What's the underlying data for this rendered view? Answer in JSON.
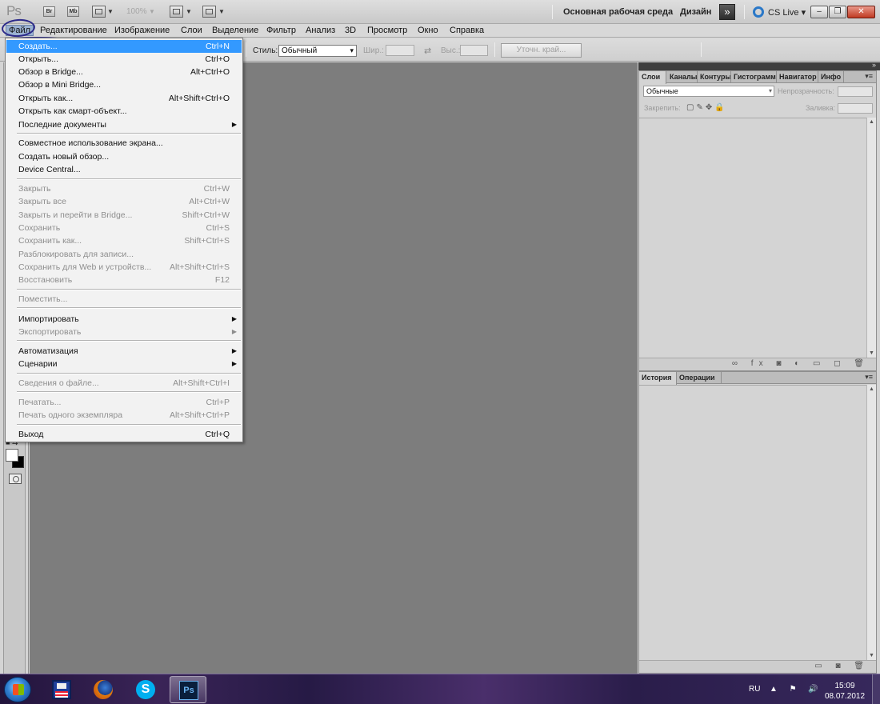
{
  "app": {
    "logo": "Ps",
    "bridge_label": "Br",
    "minibridge_label": "Mb",
    "zoom": "100%",
    "workspace_name": "Основная рабочая среда",
    "workspace_design": "Дизайн",
    "cs_live": "CS Live"
  },
  "window_controls": {
    "minimize": "–",
    "maximize": "❐",
    "close": "✕"
  },
  "menubar": [
    "Файл",
    "Редактирование",
    "Изображение",
    "Слои",
    "Выделение",
    "Фильтр",
    "Анализ",
    "3D",
    "Просмотр",
    "Окно",
    "Справка"
  ],
  "options": {
    "style_label": "Стиль:",
    "style_value": "Обычный",
    "width_label": "Шир.:",
    "height_label": "Выс.:",
    "refine_edge": "Уточн. край..."
  },
  "file_menu": [
    {
      "label": "Создать...",
      "shortcut": "Ctrl+N",
      "highlighted": true
    },
    {
      "label": "Открыть...",
      "shortcut": "Ctrl+O"
    },
    {
      "label": "Обзор в Bridge...",
      "shortcut": "Alt+Ctrl+O"
    },
    {
      "label": "Обзор в Mini Bridge..."
    },
    {
      "label": "Открыть как...",
      "shortcut": "Alt+Shift+Ctrl+O"
    },
    {
      "label": "Открыть как смарт-объект..."
    },
    {
      "label": "Последние документы",
      "submenu": true
    },
    {
      "label": "Совместное использование экрана..."
    },
    {
      "label": "Создать новый обзор..."
    },
    {
      "label": "Device Central..."
    },
    {
      "label": "Закрыть",
      "shortcut": "Ctrl+W",
      "disabled": true
    },
    {
      "label": "Закрыть все",
      "shortcut": "Alt+Ctrl+W",
      "disabled": true
    },
    {
      "label": "Закрыть и перейти в Bridge...",
      "shortcut": "Shift+Ctrl+W",
      "disabled": true
    },
    {
      "label": "Сохранить",
      "shortcut": "Ctrl+S",
      "disabled": true
    },
    {
      "label": "Сохранить как...",
      "shortcut": "Shift+Ctrl+S",
      "disabled": true
    },
    {
      "label": "Разблокировать для записи...",
      "disabled": true
    },
    {
      "label": "Сохранить для Web и устройств...",
      "shortcut": "Alt+Shift+Ctrl+S",
      "disabled": true
    },
    {
      "label": "Восстановить",
      "shortcut": "F12",
      "disabled": true
    },
    {
      "label": "Поместить...",
      "disabled": true
    },
    {
      "label": "Импортировать",
      "submenu": true
    },
    {
      "label": "Экспортировать",
      "submenu": true,
      "disabled": true
    },
    {
      "label": "Автоматизация",
      "submenu": true
    },
    {
      "label": "Сценарии",
      "submenu": true
    },
    {
      "label": "Сведения о файле...",
      "shortcut": "Alt+Shift+Ctrl+I",
      "disabled": true
    },
    {
      "label": "Печатать...",
      "shortcut": "Ctrl+P",
      "disabled": true
    },
    {
      "label": "Печать одного экземпляра",
      "shortcut": "Alt+Shift+Ctrl+P",
      "disabled": true
    },
    {
      "label": "Выход",
      "shortcut": "Ctrl+Q"
    }
  ],
  "layers_panel": {
    "tabs": [
      "Слои",
      "Каналы",
      "Контуры",
      "Гистограмма",
      "Навигатор",
      "Инфо"
    ],
    "blend_mode": "Обычные",
    "opacity_label": "Непрозрачность:",
    "lock_label": "Закрепить:",
    "fill_label": "Заливка:"
  },
  "history_panel": {
    "tabs": [
      "История",
      "Операции"
    ]
  },
  "taskbar": {
    "ps_label": "Ps",
    "skype_label": "S",
    "lang": "RU",
    "time": "15:09",
    "date": "08.07.2012"
  },
  "colors": {
    "menu_highlight": "#3399ff",
    "doc_background": "#7d7d7d",
    "annotation": "#2c2a8a"
  }
}
